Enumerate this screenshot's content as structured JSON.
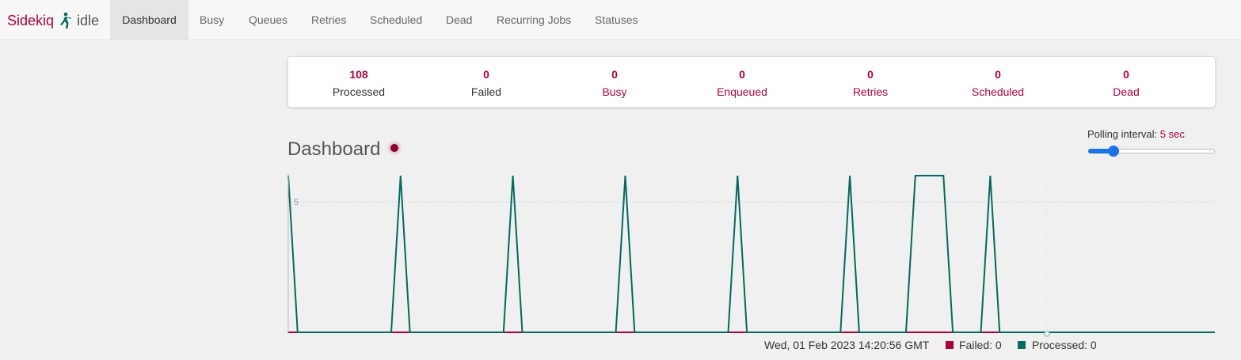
{
  "brand": {
    "name": "Sidekiq",
    "status": "idle",
    "logo_icon": "sidekiq-kicker-icon"
  },
  "nav": {
    "items": [
      {
        "label": "Dashboard",
        "active": true
      },
      {
        "label": "Busy"
      },
      {
        "label": "Queues"
      },
      {
        "label": "Retries"
      },
      {
        "label": "Scheduled"
      },
      {
        "label": "Dead"
      },
      {
        "label": "Recurring Jobs"
      },
      {
        "label": "Statuses"
      }
    ]
  },
  "summary": [
    {
      "count": "108",
      "label": "Processed"
    },
    {
      "count": "0",
      "label": "Failed"
    },
    {
      "count": "0",
      "label": "Busy"
    },
    {
      "count": "0",
      "label": "Enqueued"
    },
    {
      "count": "0",
      "label": "Retries"
    },
    {
      "count": "0",
      "label": "Scheduled"
    },
    {
      "count": "0",
      "label": "Dead"
    }
  ],
  "dashboard": {
    "title": "Dashboard",
    "polling": {
      "label": "Polling interval:",
      "value": "5 sec",
      "level": 0.2
    }
  },
  "chart_data": {
    "type": "line",
    "ylabel": "",
    "yticks": [
      5
    ],
    "ylim": [
      0,
      6
    ],
    "series": [
      {
        "name": "Failed",
        "color": "#b1003e",
        "values": [
          0,
          0,
          0,
          0,
          0,
          0,
          0,
          0,
          0,
          0,
          0,
          0,
          0,
          0,
          0,
          0,
          0,
          0,
          0,
          0,
          0,
          0,
          0,
          0,
          0,
          0,
          0,
          0,
          0,
          0,
          0,
          0,
          0,
          0,
          0,
          0,
          0,
          0,
          0,
          0,
          0,
          0,
          0,
          0,
          0,
          0,
          0,
          0,
          0,
          0,
          0,
          0,
          0,
          0,
          0,
          0,
          0,
          0,
          0,
          0,
          0,
          0,
          0,
          0,
          0,
          0,
          0,
          0,
          0,
          0,
          0,
          0,
          0,
          0,
          0,
          0,
          0,
          0,
          0,
          0,
          0,
          0,
          0,
          0,
          0,
          0,
          0,
          0,
          0,
          0,
          0,
          0,
          0,
          0,
          0,
          0,
          0,
          0,
          0,
          0,
          0,
          0,
          0,
          0,
          0,
          0,
          0,
          0,
          0,
          0,
          0,
          0,
          0,
          0,
          0,
          0,
          0,
          0,
          0,
          0,
          0,
          0,
          0,
          0,
          0,
          0,
          0,
          0,
          0,
          0,
          0,
          0,
          0,
          0,
          0,
          0,
          0,
          0,
          0,
          0,
          0,
          0,
          0,
          0,
          0,
          0,
          0,
          0,
          0,
          0,
          0,
          0,
          0,
          0,
          0,
          0,
          0,
          0,
          0,
          0,
          0,
          0,
          0,
          0,
          0,
          0,
          0,
          0,
          0,
          0,
          0,
          0,
          0,
          0,
          0,
          0,
          0,
          0,
          0,
          0,
          0,
          0,
          0,
          0,
          0,
          0,
          0,
          0,
          0,
          0,
          0,
          0,
          0,
          0,
          0,
          0,
          0,
          0,
          0,
          0,
          0,
          0,
          0,
          0,
          0,
          0,
          0,
          0,
          0,
          0
        ]
      },
      {
        "name": "Processed",
        "color": "#006b5e",
        "values": [
          6,
          0,
          0,
          0,
          0,
          0,
          0,
          0,
          0,
          0,
          0,
          0,
          6,
          0,
          0,
          0,
          0,
          0,
          0,
          0,
          0,
          0,
          0,
          0,
          6,
          0,
          0,
          0,
          0,
          0,
          0,
          0,
          0,
          0,
          0,
          0,
          6,
          0,
          0,
          0,
          0,
          0,
          0,
          0,
          0,
          0,
          0,
          0,
          6,
          0,
          0,
          0,
          0,
          0,
          0,
          0,
          0,
          0,
          0,
          0,
          6,
          0,
          0,
          0,
          0,
          0,
          0,
          6,
          6,
          6,
          6,
          0,
          0,
          0,
          0,
          6,
          0,
          0,
          0,
          0,
          0,
          0,
          0,
          0,
          0,
          0,
          0,
          0,
          0,
          0,
          0,
          0,
          0,
          0,
          0,
          0,
          0,
          0,
          0,
          0
        ]
      }
    ],
    "hover_timestamp": "Wed, 01 Feb 2023 14:20:56 GMT",
    "legend": [
      {
        "name": "Failed",
        "value": "0",
        "color": "#b1003e"
      },
      {
        "name": "Processed",
        "value": "0",
        "color": "#006b5e"
      }
    ]
  },
  "legend_text": {
    "timestamp": "Wed, 01 Feb 2023 14:20:56 GMT",
    "failed": "Failed: 0",
    "processed": "Processed: 0"
  }
}
